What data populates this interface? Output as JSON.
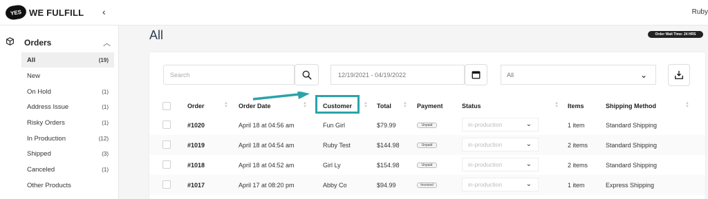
{
  "header": {
    "logo_badge": "YES",
    "logo_text": "WE FULFILL",
    "collapse_icon": "‹",
    "user": "Ruby"
  },
  "sidebar": {
    "section": "Orders",
    "items": [
      {
        "label": "All",
        "count": "(19)",
        "active": true
      },
      {
        "label": "New",
        "count": ""
      },
      {
        "label": "On Hold",
        "count": "(1)"
      },
      {
        "label": "Address Issue",
        "count": "(1)"
      },
      {
        "label": "Risky Orders",
        "count": "(1)"
      },
      {
        "label": "In Production",
        "count": "(12)"
      },
      {
        "label": "Shipped",
        "count": "(3)"
      },
      {
        "label": "Canceled",
        "count": "(1)"
      },
      {
        "label": "Other Products",
        "count": ""
      }
    ]
  },
  "page": {
    "title": "All",
    "wait_badge": "Order Wait Time: 24 HRS"
  },
  "filters": {
    "search_placeholder": "Search",
    "date_range": "12/19/2021 - 04/19/2022",
    "select_value": "All"
  },
  "table": {
    "columns": {
      "order": "Order",
      "date": "Order Date",
      "customer": "Customer",
      "total": "Total",
      "payment": "Payment",
      "status": "Status",
      "items": "Items",
      "shipping": "Shipping Method"
    },
    "rows": [
      {
        "order": "#1020",
        "date": "April 18 at 04:56 am",
        "customer": "Fun Girl",
        "total": "$79.99",
        "payment": "Unpaid",
        "status": "in-production",
        "items": "1 item",
        "shipping": "Standard Shipping"
      },
      {
        "order": "#1019",
        "date": "April 18 at 04:54 am",
        "customer": "Ruby Test",
        "total": "$144.98",
        "payment": "Unpaid",
        "status": "in-production",
        "items": "2 items",
        "shipping": "Standard Shipping"
      },
      {
        "order": "#1018",
        "date": "April 18 at 04:52 am",
        "customer": "Girl Ly",
        "total": "$154.98",
        "payment": "Unpaid",
        "status": "in-production",
        "items": "2 items",
        "shipping": "Standard Shipping"
      },
      {
        "order": "#1017",
        "date": "April 17 at 08:20 pm",
        "customer": "Abby Co",
        "total": "$94.99",
        "payment": "Invoiced",
        "status": "in-production",
        "items": "1 item",
        "shipping": "Express Shipping"
      }
    ]
  },
  "colors": {
    "highlight": "#2aa3a9",
    "title": "#2c3e50"
  }
}
